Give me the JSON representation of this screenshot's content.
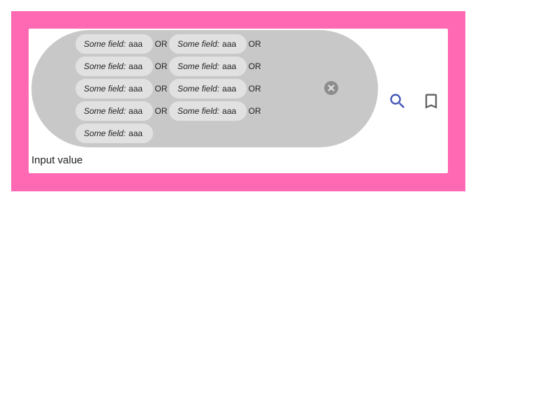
{
  "query": {
    "rows": [
      {
        "chips": [
          {
            "field": "Some field:",
            "value": "aaa"
          },
          {
            "field": "Some field:",
            "value": "aaa"
          }
        ],
        "operators": [
          "OR",
          "OR"
        ]
      },
      {
        "chips": [
          {
            "field": "Some field:",
            "value": "aaa"
          },
          {
            "field": "Some field:",
            "value": "aaa"
          }
        ],
        "operators": [
          "OR",
          "OR"
        ]
      },
      {
        "chips": [
          {
            "field": "Some field:",
            "value": "aaa"
          },
          {
            "field": "Some field:",
            "value": "aaa"
          }
        ],
        "operators": [
          "OR",
          "OR"
        ]
      },
      {
        "chips": [
          {
            "field": "Some field:",
            "value": "aaa"
          },
          {
            "field": "Some field:",
            "value": "aaa"
          }
        ],
        "operators": [
          "OR",
          "OR"
        ]
      },
      {
        "chips": [
          {
            "field": "Some field:",
            "value": "aaa"
          }
        ],
        "operators": []
      }
    ]
  },
  "input": {
    "value": "Input value"
  },
  "actions": {
    "clear_icon": "close-circle-icon",
    "search_icon": "search-icon",
    "bookmark_icon": "bookmark-icon"
  },
  "colors": {
    "frame_background": "#ff69b4",
    "card_background": "#ffffff",
    "pill_background": "#c8c8c8",
    "chip_background": "#e1e1e1",
    "search_icon": "#3f51b5",
    "bookmark_icon": "#616161"
  }
}
